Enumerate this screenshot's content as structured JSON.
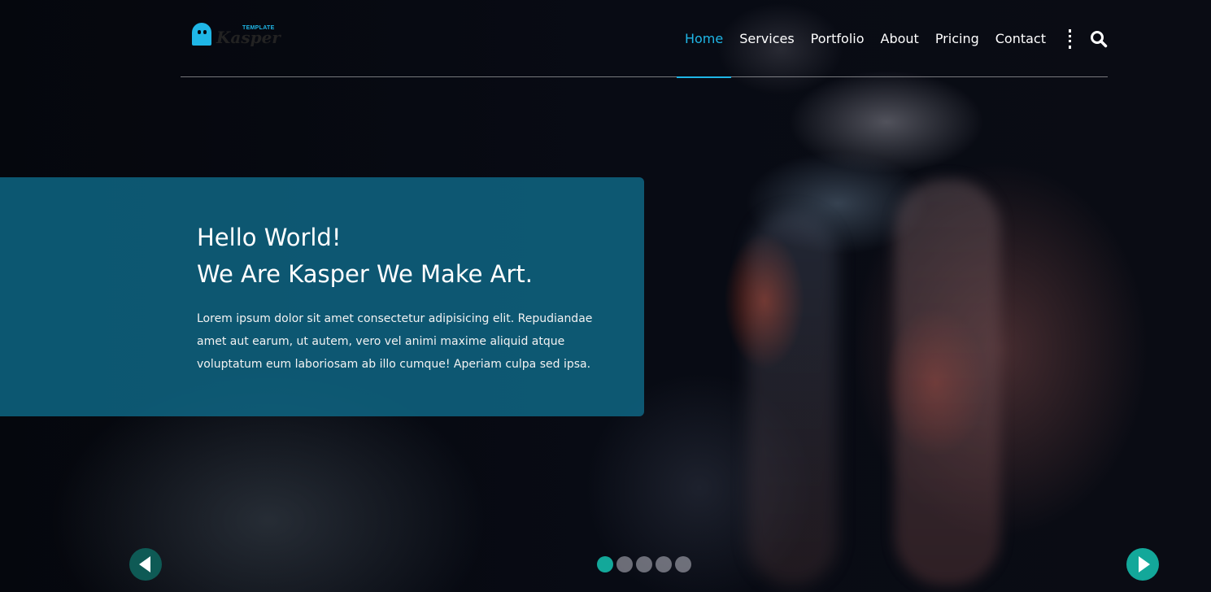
{
  "header": {
    "logo": {
      "word": "Kasper",
      "tag": "TEMPLATE"
    },
    "nav": [
      {
        "label": "Home",
        "active": true
      },
      {
        "label": "Services",
        "active": false
      },
      {
        "label": "Portfolio",
        "active": false
      },
      {
        "label": "About",
        "active": false
      },
      {
        "label": "Pricing",
        "active": false
      },
      {
        "label": "Contact",
        "active": false
      }
    ],
    "menu_icon": "vertical-dots-icon",
    "search_icon": "search-icon"
  },
  "hero": {
    "title_line1": "Hello World!",
    "title_line2": "We Are Kasper We Make Art.",
    "text": "Lorem ipsum dolor sit amet consectetur adipisicing elit. Repudiandae amet aut earum, ut autem, vero vel animi maxime aliquid atque voluptatum eum laboriosam ab illo cumque! Aperiam culpa sed ipsa.",
    "prev_icon": "chevron-left-icon",
    "next_icon": "chevron-right-icon",
    "slides": {
      "count": 5,
      "active_index": 0
    }
  },
  "colors": {
    "accent": "#1fb6e6",
    "panel": "#0f6987",
    "bullet_active": "#13a89a",
    "arrow_next": "#13a89a",
    "arrow_prev": "#0e5a55"
  }
}
